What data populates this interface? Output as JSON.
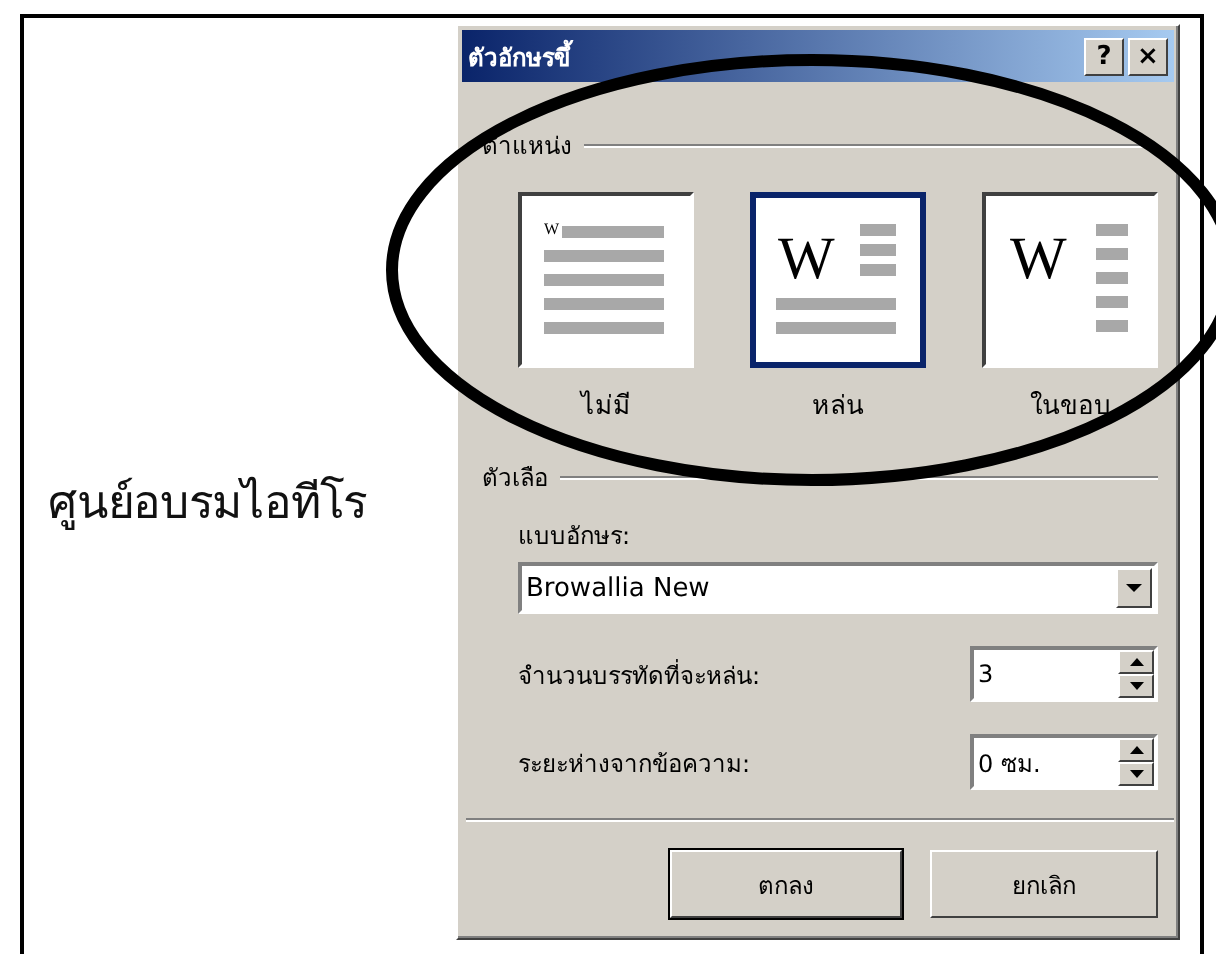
{
  "document": {
    "text": "ศูนย์อบรมไอทีโร"
  },
  "dialog": {
    "title": "ตัวอักษรขึ้",
    "help_button": "?",
    "close_button": "×",
    "position": {
      "label": "ตำแหน่ง",
      "options": [
        {
          "kind": "none",
          "label": "ไม่มี",
          "letter": "W",
          "selected": false
        },
        {
          "kind": "dropped",
          "label": "หล่น",
          "letter": "W",
          "selected": true
        },
        {
          "kind": "in-margin",
          "label": "ในขอบ",
          "letter": "W",
          "selected": false
        }
      ]
    },
    "options": {
      "label": "ตัวเลือ",
      "font_label": "แบบอักษร:",
      "font_value": "Browallia New",
      "fields": [
        {
          "label": "จำนวนบรรทัดที่จะหล่น:",
          "value": "3"
        },
        {
          "label": "ระยะห่างจากข้อความ:",
          "value": "0 ซม."
        }
      ]
    },
    "buttons": [
      {
        "label": "ตกลง",
        "default": true
      },
      {
        "label": "ยกเลิก",
        "default": false
      }
    ]
  },
  "annotation": {
    "kind": "ellipse"
  }
}
